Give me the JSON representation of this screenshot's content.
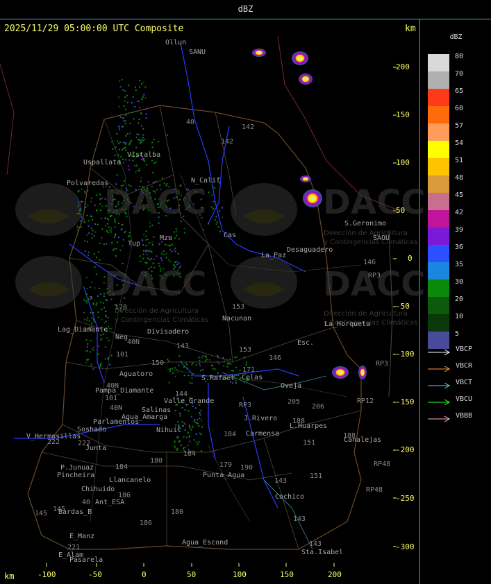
{
  "header": {
    "title": "dBZ"
  },
  "map": {
    "title": "2025/11/29 05:00:00 UTC Composite",
    "unit_top": "km",
    "unit_bottom": "km",
    "x_ticks": [
      "-100",
      "-50",
      "0",
      "50",
      "100",
      "150",
      "200"
    ],
    "y_ticks": [
      "200",
      "150",
      "100",
      "50",
      "0",
      "-50",
      "-100",
      "-150",
      "-200",
      "-250",
      "-300"
    ],
    "places": [
      "Ollun",
      "SANU",
      "Uspallata",
      "Polvaredas",
      "N_Calif",
      "S.Geronimo",
      "SAOU",
      "Desaguadero",
      "La_Paz",
      "Nacunan",
      "La_Horqueta",
      "Lag_Diamante",
      "Divisadero",
      "Aguatoro",
      "Pampa_Diamante",
      "Valle_Grande",
      "Salinas",
      "Nihuil",
      "Parlamentos",
      "Soshado",
      "V_Hermosillas",
      "Junta",
      "P.Junuaz",
      "Pincheira",
      "Llancanelo",
      "Chihuido",
      "Ant_ESA",
      "Bardas_B",
      "E_Manz",
      "E_Alam",
      "Pasarela",
      "Punta_Agua",
      "Agua_Escond",
      "Carmensa",
      "Cochico",
      "Sta.Isabel",
      "L.Huarpes",
      "Canalejas",
      "Oveja",
      "Esc.",
      "Neg",
      "Cas",
      "Colas",
      "J.Rivero",
      "Vistalba",
      "Agua_Amarga",
      "S.Rafael",
      "Mza",
      "Tup"
    ],
    "routes": [
      "40",
      "142",
      "142",
      "146",
      "153",
      "153",
      "146",
      "143",
      "150",
      "40N",
      "40N",
      "40N",
      "101",
      "101",
      "144",
      "184",
      "184",
      "184",
      "186",
      "180",
      "180",
      "186",
      "145",
      "145",
      "40",
      "143",
      "143",
      "151",
      "151",
      "143",
      "205",
      "206",
      "188",
      "171",
      "190",
      "179",
      "188",
      "RP3",
      "RP3",
      "RP3",
      "RP12",
      "RP48",
      "RP48",
      "222",
      "221",
      "222",
      "178"
    ],
    "watermarks": {
      "logo": "DACC",
      "sub1": "Dirección de Agricultura",
      "sub2": "y Contingencias Climáticas"
    }
  },
  "legend": {
    "title": "dBZ",
    "levels": [
      {
        "label": "80",
        "color": "#d8d8d8"
      },
      {
        "label": "70",
        "color": "#b0b0b0"
      },
      {
        "label": "65",
        "color": "#ff3a1a"
      },
      {
        "label": "60",
        "color": "#ff6a0a"
      },
      {
        "label": "57",
        "color": "#ff9c5a"
      },
      {
        "label": "54",
        "color": "#ffff00"
      },
      {
        "label": "51",
        "color": "#ffc400"
      },
      {
        "label": "48",
        "color": "#d99a3a"
      },
      {
        "label": "45",
        "color": "#c86f8f"
      },
      {
        "label": "42",
        "color": "#c0149a"
      },
      {
        "label": "39",
        "color": "#7a1ad8"
      },
      {
        "label": "36",
        "color": "#2a50ff"
      },
      {
        "label": "35",
        "color": "#1a86e0"
      },
      {
        "label": "30",
        "color": "#0a8a0a"
      },
      {
        "label": "20",
        "color": "#0c5a0c"
      },
      {
        "label": "10",
        "color": "#0a3a0a"
      },
      {
        "label": "5",
        "color": "#4a4a9a"
      }
    ],
    "radars": [
      {
        "label": "VBCP",
        "color": "#ffffff"
      },
      {
        "label": "VBCR",
        "color": "#ff9a3a"
      },
      {
        "label": "VBCT",
        "color": "#5ad0ff"
      },
      {
        "label": "VBCU",
        "color": "#3aff3a"
      },
      {
        "label": "VBBB",
        "color": "#ffb0c0"
      }
    ]
  }
}
